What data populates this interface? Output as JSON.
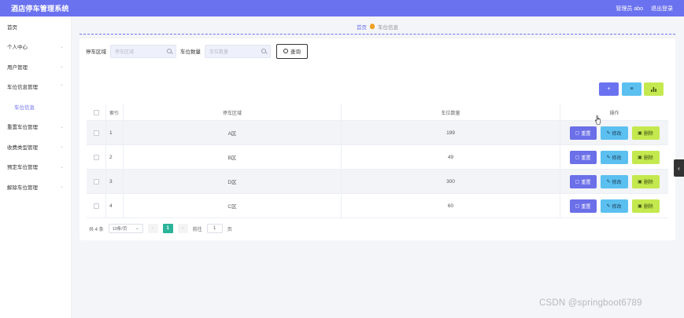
{
  "app": {
    "title": "酒店停车管理系统"
  },
  "header": {
    "user_label": "管理员 abo",
    "logout_label": "退出登录"
  },
  "sidebar": {
    "items": [
      {
        "label": "首页",
        "arrow": ""
      },
      {
        "label": "个人中心",
        "arrow": "⌄"
      },
      {
        "label": "用户管理",
        "arrow": "⌄"
      },
      {
        "label": "车位信息管理",
        "arrow": "⌃"
      },
      {
        "label": "车位信息",
        "arrow": ""
      },
      {
        "label": "重置车位管理",
        "arrow": "⌄"
      },
      {
        "label": "收费类型管理",
        "arrow": "⌄"
      },
      {
        "label": "预定车位管理",
        "arrow": "⌄"
      },
      {
        "label": "解除车位管理",
        "arrow": "⌄"
      }
    ]
  },
  "breadcrumb": {
    "home": "首页",
    "current": "车位信息"
  },
  "search": {
    "area_label": "停车区域",
    "area_placeholder": "停车区域",
    "count_label": "车位数量",
    "count_placeholder": "车位数量",
    "query_label": "查询"
  },
  "toolbar": {
    "add_icon": "+",
    "delete_icon": "🗑",
    "chart_icon": "📊"
  },
  "table": {
    "headers": {
      "index": "索引",
      "area": "停车区域",
      "count": "车位数量",
      "op": "操作"
    },
    "rows": [
      {
        "index": "1",
        "area": "A区",
        "count": "199"
      },
      {
        "index": "2",
        "area": "B区",
        "count": "49"
      },
      {
        "index": "3",
        "area": "D区",
        "count": "300"
      },
      {
        "index": "4",
        "area": "C区",
        "count": "60"
      }
    ],
    "actions": {
      "reset": "重置",
      "edit": "修改",
      "delete": "删除"
    }
  },
  "pager": {
    "total": "共 4 条",
    "size": "10条/页",
    "current": "1",
    "goto_label": "前往",
    "goto_value": "1",
    "page_label": "页"
  },
  "watermark": "CSDN @springboot6789",
  "colors": {
    "primary": "#6b72ef",
    "edit": "#5bc0f0",
    "delete": "#c4e94f",
    "page_active": "#2bb49a"
  }
}
